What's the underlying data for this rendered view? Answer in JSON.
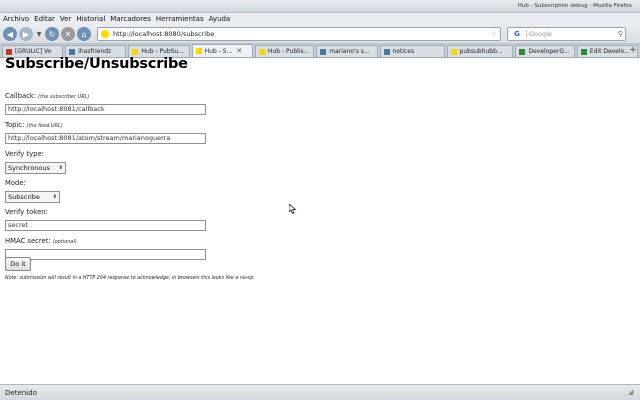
{
  "window": {
    "title": "Hub - Subscription debug - Mozilla Firefox"
  },
  "menu": [
    "Archivo",
    "Editar",
    "Ver",
    "Historial",
    "Marcadores",
    "Herramientas",
    "Ayuda"
  ],
  "nav": {
    "url": "http://localhost:8080/subscribe",
    "search_engine": "G",
    "search_placeholder": "Google"
  },
  "tabs": [
    {
      "label": "[GRULIC] Vo",
      "favicon_color": "#c0392b",
      "active": false
    },
    {
      "label": "ihasfriendz",
      "favicon_color": "#4a7b9d",
      "active": false
    },
    {
      "label": "Hub - PubSu...",
      "favicon_color": "#ffd800",
      "active": false
    },
    {
      "label": "Hub - S...",
      "favicon_color": "#ffd800",
      "active": true,
      "close": "✕"
    },
    {
      "label": "Hub - Publis...",
      "favicon_color": "#ffd800",
      "active": false
    },
    {
      "label": "mariano's s...",
      "favicon_color": "#4a7b9d",
      "active": false
    },
    {
      "label": "notices",
      "favicon_color": "#4a7b9d",
      "active": false
    },
    {
      "label": "pubsubhubb...",
      "favicon_color": "#ffd800",
      "active": false
    },
    {
      "label": "DeveloperG...",
      "favicon_color": "#2e8b3a",
      "active": false
    },
    {
      "label": "Edit Develo...",
      "favicon_color": "#2e8b3a",
      "active": false
    }
  ],
  "page": {
    "heading": "Subscribe/Unsubscribe",
    "callback": {
      "label": "Callback:",
      "hint": "(the subscriber URL)",
      "value": "http://localhost:8081/callback"
    },
    "topic": {
      "label": "Topic:",
      "hint": "(the feed URL)",
      "value": "http://localhost:8081/atom/stream/marianoguerra"
    },
    "verify_type": {
      "label": "Verify type:",
      "value": "Synchronous"
    },
    "mode": {
      "label": "Mode:",
      "value": "Subscribe"
    },
    "verify_token": {
      "label": "Verify token:",
      "value": "secret"
    },
    "hmac": {
      "label": "HMAC secret:",
      "hint": "(optional)",
      "value": ""
    },
    "submit_label": "Do it",
    "note": "Note: submission will result in a HTTP 204 response to acknowledge; in browsers this looks like a no-op"
  },
  "status": {
    "text": "Detenido"
  }
}
